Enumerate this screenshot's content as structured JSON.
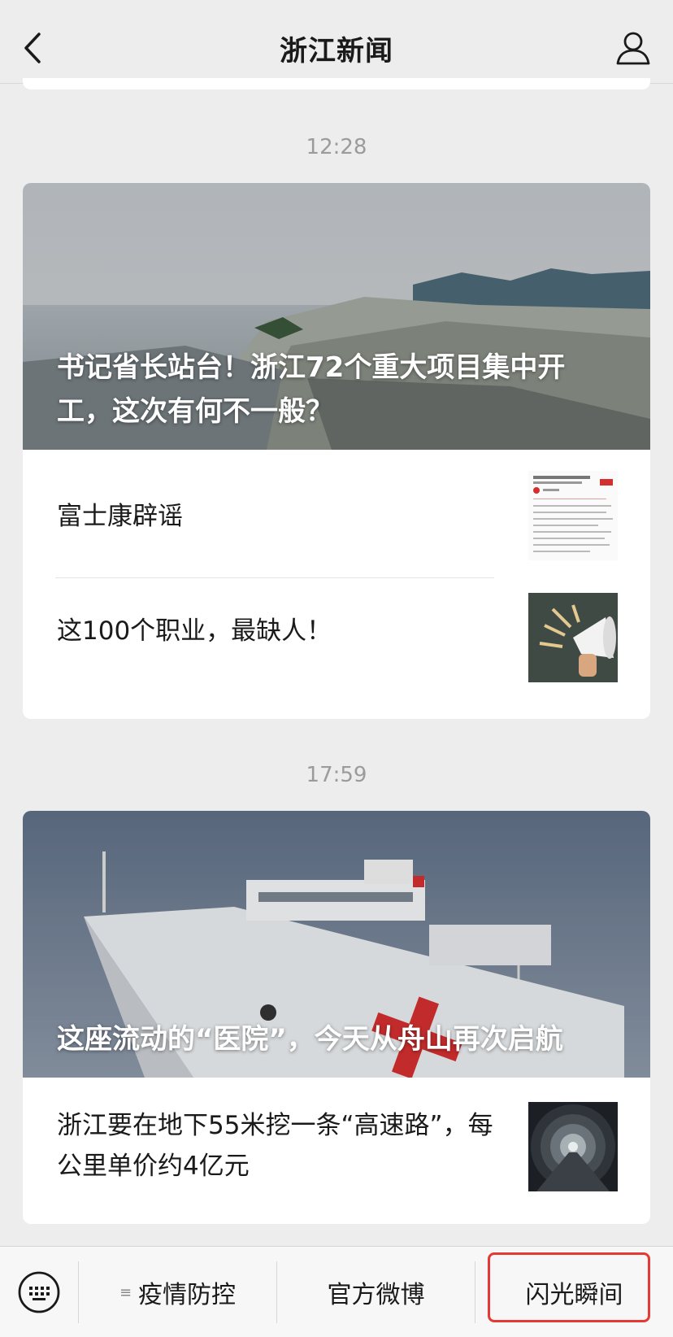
{
  "header": {
    "title": "浙江新闻"
  },
  "feed": [
    {
      "time": "12:28",
      "hero_title": "书记省长站台！浙江72个重大项目集中开工，这次有何不一般？",
      "items": [
        {
          "title": "富士康辟谣",
          "thumb_icon": "document-thumbnail"
        },
        {
          "title": "这100个职业，最缺人！",
          "thumb_icon": "megaphone-thumbnail"
        }
      ]
    },
    {
      "time": "17:59",
      "hero_title": "这座流动的“医院”，今天从舟山再次启航",
      "items": [
        {
          "title": "浙江要在地下55米挖一条“高速路”，每公里单价约4亿元",
          "thumb_icon": "tunnel-thumbnail"
        }
      ]
    }
  ],
  "menu": [
    {
      "label": "疫情防控",
      "has_submenu": true
    },
    {
      "label": "官方微博",
      "has_submenu": false
    },
    {
      "label": "闪光瞬间",
      "has_submenu": false
    }
  ],
  "colors": {
    "highlight": "#e53935",
    "background": "#ededed"
  }
}
